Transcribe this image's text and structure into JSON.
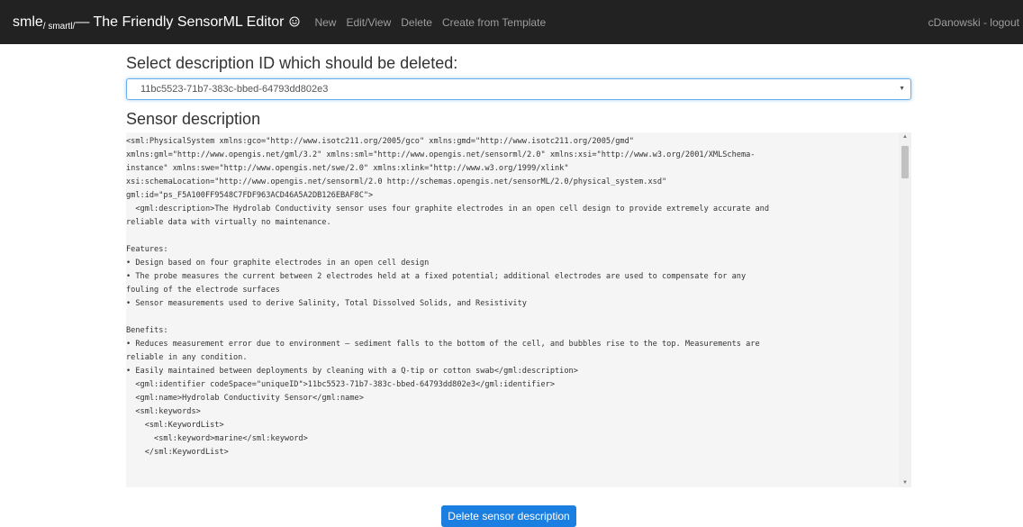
{
  "navbar": {
    "brand_main": "smle",
    "brand_sub": "/ smartl/",
    "brand_rest": " — The Friendly SensorML Editor",
    "brand_icon": "smile-icon",
    "links": [
      "New",
      "Edit/View",
      "Delete",
      "Create from Template"
    ],
    "user": "cDanowski - logout"
  },
  "main": {
    "select_heading": "Select description ID which should be deleted:",
    "selected_id": "11bc5523-71b7-383c-bbed-64793dd802e3",
    "description_heading": "Sensor description",
    "description_xml": "<sml:PhysicalSystem xmlns:gco=\"http://www.isotc211.org/2005/gco\" xmlns:gmd=\"http://www.isotc211.org/2005/gmd\"\nxmlns:gml=\"http://www.opengis.net/gml/3.2\" xmlns:sml=\"http://www.opengis.net/sensorml/2.0\" xmlns:xsi=\"http://www.w3.org/2001/XMLSchema-\ninstance\" xmlns:swe=\"http://www.opengis.net/swe/2.0\" xmlns:xlink=\"http://www.w3.org/1999/xlink\"\nxsi:schemaLocation=\"http://www.opengis.net/sensorml/2.0 http://schemas.opengis.net/sensorML/2.0/physical_system.xsd\"\ngml:id=\"ps_F5A100FF9548C7FDF963ACD46A5A2DB126EBAF8C\">\n  <gml:description>The Hydrolab Conductivity sensor uses four graphite electrodes in an open cell design to provide extremely accurate and\nreliable data with virtually no maintenance.\n\nFeatures:\n• Design based on four graphite electrodes in an open cell design\n• The probe measures the current between 2 electrodes held at a fixed potential; additional electrodes are used to compensate for any\nfouling of the electrode surfaces\n• Sensor measurements used to derive Salinity, Total Dissolved Solids, and Resistivity\n\nBenefits:\n• Reduces measurement error due to environment – sediment falls to the bottom of the cell, and bubbles rise to the top. Measurements are\nreliable in any condition.\n• Easily maintained between deployments by cleaning with a Q-tip or cotton swab</gml:description>\n  <gml:identifier codeSpace=\"uniqueID\">11bc5523-71b7-383c-bbed-64793dd802e3</gml:identifier>\n  <gml:name>Hydrolab Conductivity Sensor</gml:name>\n  <sml:keywords>\n    <sml:KeywordList>\n      <sml:keyword>marine</sml:keyword>\n    </sml:KeywordList>",
    "delete_button": "Delete sensor description"
  },
  "colors": {
    "navbar_bg": "#222222",
    "nav_link": "#9d9d9d",
    "button_bg": "#1a7fe0",
    "code_bg": "#f5f5f5"
  }
}
